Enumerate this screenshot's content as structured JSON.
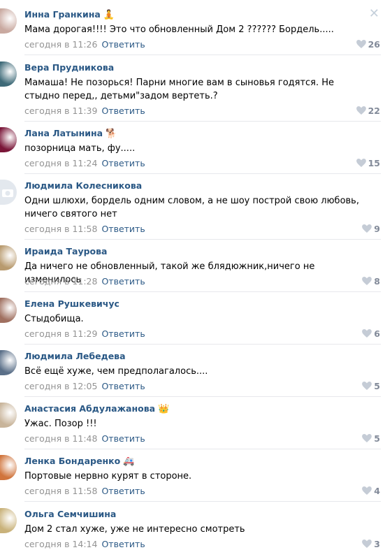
{
  "comments": [
    {
      "author": "Инна Гранкина",
      "emoji": "🧘",
      "text": "Мама дорогая!!!! Это что обновленный Дом 2 ?????? Бордель.....",
      "time": "сегодня в 11:26",
      "reply": "Ответить",
      "likes": "26",
      "avatar_color": "#c9a9a0"
    },
    {
      "author": "Вера Прудникова",
      "emoji": "",
      "text": "Мамаша! Не позорься! Парни многие вам в сыновья годятся. Не стыдно перед,, детьми\"задом вертеть.?",
      "time": "сегодня в 11:39",
      "reply": "Ответить",
      "likes": "22",
      "avatar_color": "#3e6a78"
    },
    {
      "author": "Лана Латынина",
      "emoji": "🐕",
      "text": "позорница мать, фу.....",
      "time": "сегодня в 11:24",
      "reply": "Ответить",
      "likes": "15",
      "avatar_color": "#7a1638"
    },
    {
      "author": "Людмила Колесникова",
      "emoji": "",
      "text": "Одни шлюхи, бордель одним словом, а не шоу построй свою любовь, ничего святого нет",
      "time": "сегодня в 11:58",
      "reply": "Ответить",
      "likes": "9",
      "avatar_color": "#e3e8ee"
    },
    {
      "author": "Ираида Таурова",
      "emoji": "",
      "text": "Да ничего не обновленный, такой же блядюжник,ничего не изменилось",
      "time": "сегодня в 11:28",
      "reply": "Ответить",
      "likes": "8",
      "avatar_color": "#b89a6e"
    },
    {
      "author": "Елена Рушкевичус",
      "emoji": "",
      "text": "Стыдобища.",
      "time": "сегодня в 11:29",
      "reply": "Ответить",
      "likes": "6",
      "avatar_color": "#a07060"
    },
    {
      "author": "Людмила Лебедева",
      "emoji": "",
      "text": "Всё ещё хуже, чем предполагалось....",
      "time": "сегодня в 12:05",
      "reply": "Ответить",
      "likes": "5",
      "avatar_color": "#5a6f88"
    },
    {
      "author": "Анастасия Абдулажанова",
      "emoji": "👑",
      "text": "Ужас. Позор !!!",
      "time": "сегодня в 11:48",
      "reply": "Ответить",
      "likes": "5",
      "avatar_color": "#c8b49a"
    },
    {
      "author": "Ленка Бондаренко",
      "emoji": "🚑",
      "text": "Портовые нервно курят в стороне.",
      "time": "сегодня в 11:58",
      "reply": "Ответить",
      "likes": "4",
      "avatar_color": "#d0743c"
    },
    {
      "author": "Ольга Семчишина",
      "emoji": "",
      "text": "Дом 2 стал хуже, уже не интересно смотреть",
      "time": "сегодня в 14:14",
      "reply": "Ответить",
      "likes": "3",
      "avatar_color": "#c9b27a"
    }
  ],
  "close_symbol": "✕"
}
